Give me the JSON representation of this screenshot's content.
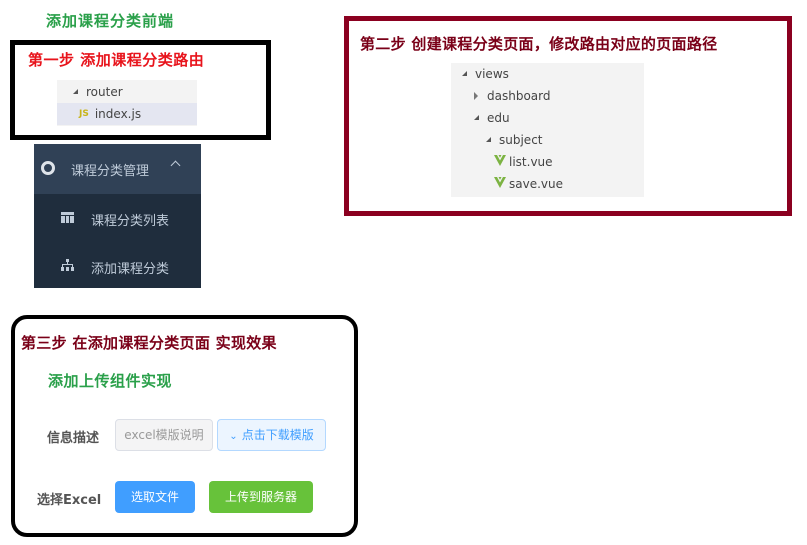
{
  "main_title": "添加课程分类前端",
  "step1": {
    "title": "第一步  添加课程分类路由",
    "tree": [
      {
        "label": "router",
        "type": "folder-open",
        "icon": "triangle-down-icon"
      },
      {
        "label": "index.js",
        "type": "file-js",
        "icon": "js-file-icon",
        "selected": true
      }
    ]
  },
  "sidebar": {
    "header": {
      "label": "课程分类管理",
      "icon": "circle-icon",
      "expanded": true
    },
    "items": [
      {
        "label": "课程分类列表",
        "icon": "table-icon"
      },
      {
        "label": "添加课程分类",
        "icon": "tree-icon"
      }
    ],
    "colors": {
      "header_bg": "#304156",
      "submenu_bg": "#1f2d3d",
      "text": "#bfcbd9"
    }
  },
  "step2": {
    "title": "第二步  创建课程分类页面，修改路由对应的页面路径",
    "tree": [
      {
        "label": "views",
        "type": "folder-open",
        "depth": 0
      },
      {
        "label": "dashboard",
        "type": "folder-closed",
        "depth": 1
      },
      {
        "label": "edu",
        "type": "folder-open",
        "depth": 1
      },
      {
        "label": "subject",
        "type": "folder-open",
        "depth": 2
      },
      {
        "label": "list.vue",
        "type": "file-vue",
        "depth": 3
      },
      {
        "label": "save.vue",
        "type": "file-vue",
        "depth": 3
      }
    ]
  },
  "step3": {
    "title": "第三步  在添加课程分类页面  实现效果",
    "subtitle": "添加上传组件实现",
    "form": {
      "row1": {
        "label": "信息描述",
        "desc_button": "excel模版说明",
        "download_button": "点击下载模版",
        "download_icon": "⌄"
      },
      "row2": {
        "label": "选择Excel",
        "pick_button": "选取文件",
        "upload_button": "上传到服务器"
      }
    }
  },
  "colors": {
    "green_title": "#2aa04a",
    "step1_red": "#e8141c",
    "step_dark_red": "#7a0018",
    "box2_border": "#8b0020",
    "primary_blue": "#409eff",
    "success_green": "#67c23a"
  }
}
